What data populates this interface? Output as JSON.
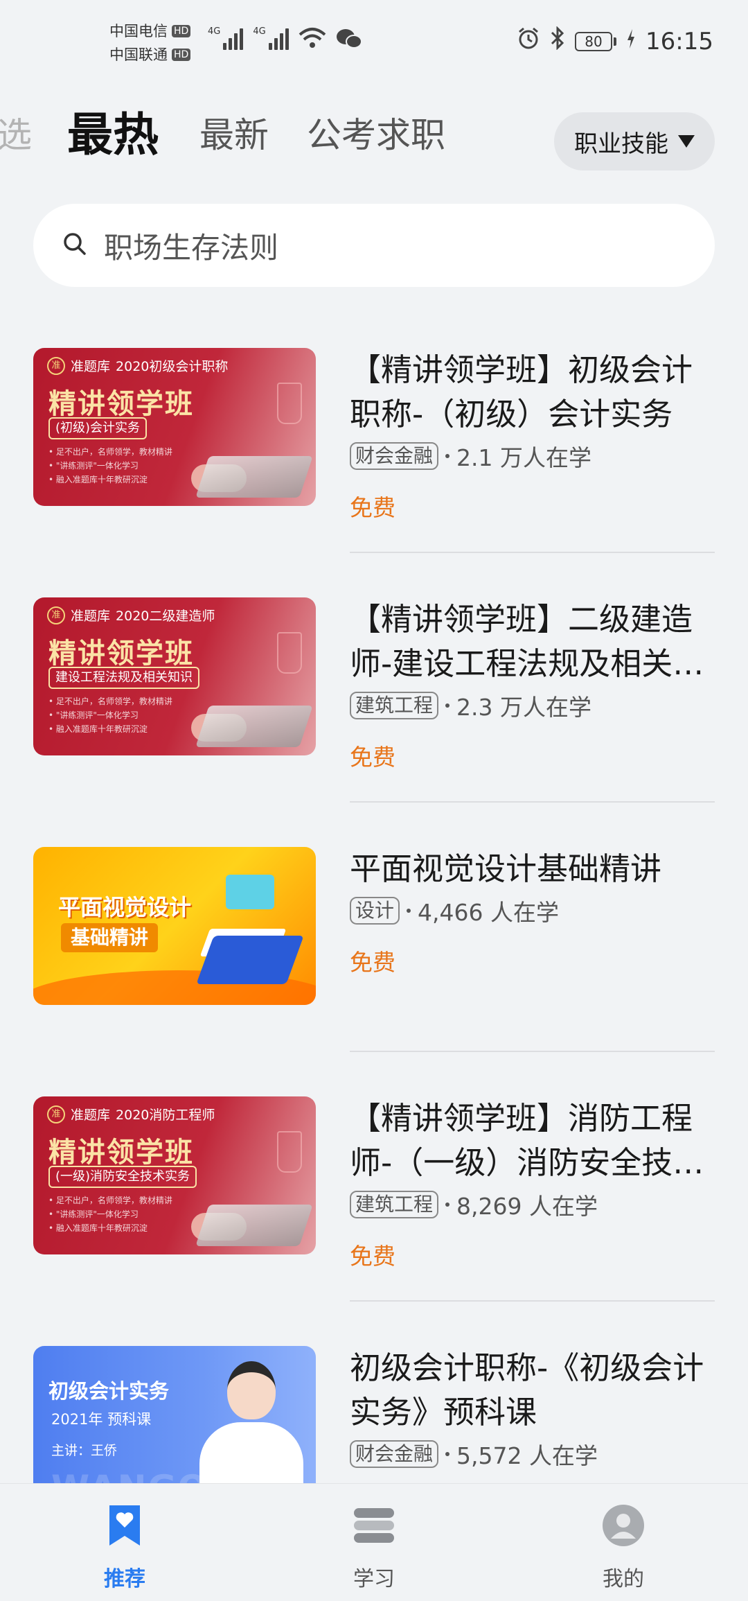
{
  "status_bar": {
    "carrier1": "中国电信",
    "carrier2": "中国联通",
    "hd": "HD",
    "net1": "4G",
    "net2": "4G",
    "battery": "80",
    "time": "16:15"
  },
  "tabs": {
    "partial": "选",
    "active": "最热",
    "items": [
      "最新",
      "公考求职"
    ],
    "category_button": "职业技能"
  },
  "search": {
    "placeholder": "职场生存法则"
  },
  "courses": [
    {
      "title": "【精讲领学班】初级会计职称-（初级）会计实务",
      "tag": "财会金融",
      "count": "2.1 万人在学",
      "price": "免费",
      "thumb": {
        "brand": "准题库",
        "year_line": "2020初级会计职称",
        "headline": "精讲领学班",
        "sub": "(初级)会计实务",
        "bullets": [
          "• 足不出户，名师领学，教材精讲",
          "• \"讲练测评\"一体化学习",
          "• 融入准题库十年教研沉淀"
        ]
      }
    },
    {
      "title": "【精讲领学班】二级建造师-建设工程法规及相关知识",
      "tag": "建筑工程",
      "count": "2.3 万人在学",
      "price": "免费",
      "thumb": {
        "brand": "准题库",
        "year_line": "2020二级建造师",
        "headline": "精讲领学班",
        "sub": "建设工程法规及相关知识",
        "bullets": [
          "• 足不出户，名师领学，教材精讲",
          "• \"讲练测评\"一体化学习",
          "• 融入准题库十年教研沉淀"
        ]
      }
    },
    {
      "title": "平面视觉设计基础精讲",
      "tag": "设计",
      "count": "4,466 人在学",
      "price": "免费",
      "thumb": {
        "line1": "平面视觉设计",
        "line2": "基础精讲"
      }
    },
    {
      "title": "【精讲领学班】消防工程师-（一级）消防安全技术实务",
      "tag": "建筑工程",
      "count": "8,269 人在学",
      "price": "免费",
      "thumb": {
        "brand": "准题库",
        "year_line": "2020消防工程师",
        "headline": "精讲领学班",
        "sub": "(一级)消防安全技术实务",
        "bullets": [
          "• 足不出户，名师领学，教材精讲",
          "• \"讲练测评\"一体化学习",
          "• 融入准题库十年教研沉淀"
        ]
      }
    },
    {
      "title": "初级会计职称-《初级会计实务》预科课",
      "tag": "财会金融",
      "count": "5,572 人在学",
      "price": "",
      "thumb": {
        "line1": "初级会计实务",
        "line2": "2021年 预科课",
        "line3": "主讲：王侨",
        "watermark": "WANGQIAO"
      }
    }
  ],
  "bottom_nav": [
    {
      "label": "推荐",
      "icon": "bookmark-heart-icon",
      "active": true
    },
    {
      "label": "学习",
      "icon": "book-stack-icon",
      "active": false
    },
    {
      "label": "我的",
      "icon": "user-avatar-icon",
      "active": false
    }
  ],
  "colors": {
    "accent": "#2a7cf0",
    "price": "#e8751a",
    "background": "#f1f3f5"
  }
}
